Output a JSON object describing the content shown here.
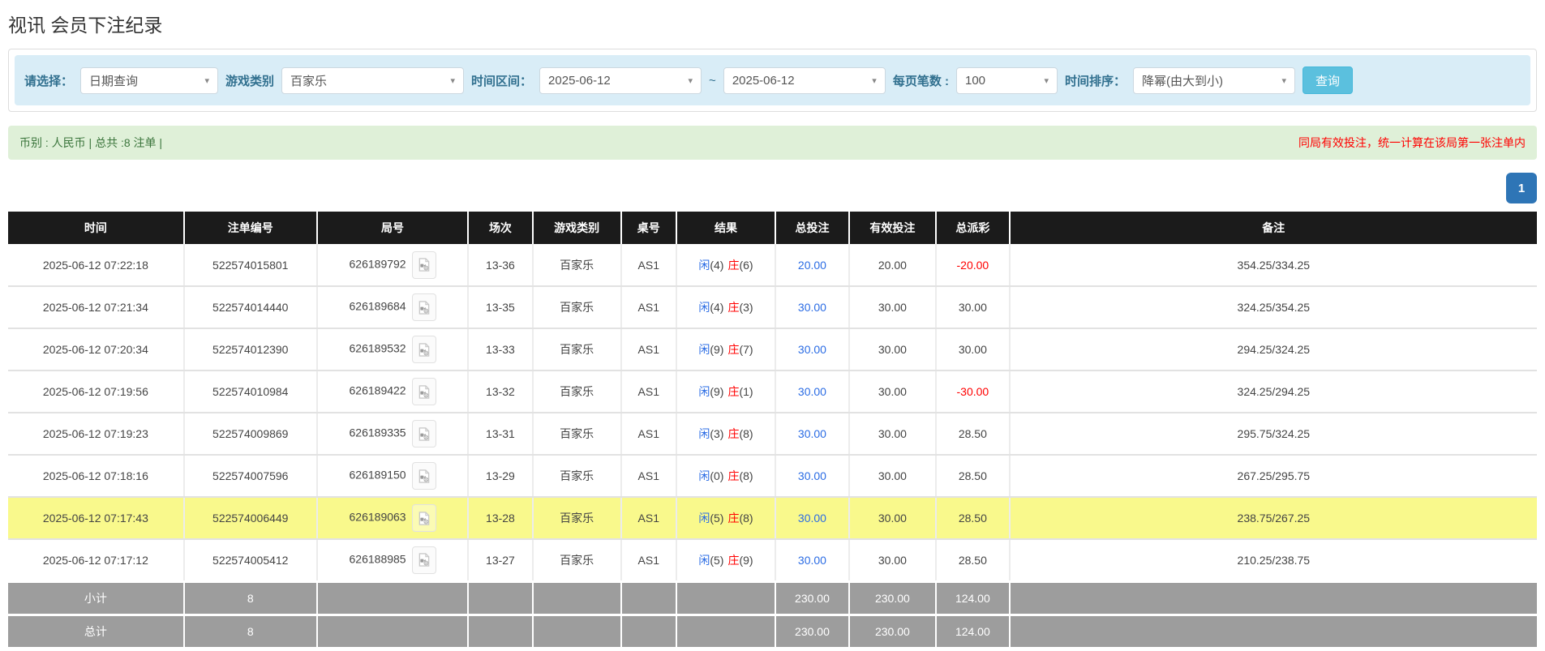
{
  "page": {
    "title": "视讯 会员下注纪录"
  },
  "filters": {
    "select_label": "请选择：",
    "select_value": "日期查询",
    "game_type_label": "游戏类别",
    "game_type_value": "百家乐",
    "date_range_label": "时间区间：",
    "date_from": "2025-06-12",
    "tilde": "~",
    "date_to": "2025-06-12",
    "page_size_label": "每页笔数 :",
    "page_size_value": "100",
    "sort_label": "时间排序：",
    "sort_value": "降幂(由大到小)",
    "search_button": "查询"
  },
  "summary": {
    "left": "币别 : 人民币 | 总共 :8 注单 |",
    "right": "同局有效投注，统一计算在该局第一张注单内"
  },
  "pagination": {
    "page": "1"
  },
  "icons": {
    "dropdown_arrow": "▾",
    "video_icon_name": "video-replay-icon"
  },
  "colors": {
    "filter_bar_bg": "#d9edf7",
    "filter_label": "#31708f",
    "search_button_bg": "#5bc0de",
    "summary_green_bg": "#dff0d8",
    "summary_text_green": "#3c763d",
    "notice_red": "#ff0000",
    "pagination_bg": "#2e75b6",
    "header_bg": "#1b1b1b",
    "highlight_row": "#f9f98c",
    "amount_blue": "#2b6ce4",
    "negative_red": "#ff0000",
    "footer_bg": "#9d9d9d"
  },
  "table": {
    "headers": [
      "时间",
      "注单编号",
      "局号",
      "场次",
      "游戏类别",
      "桌号",
      "结果",
      "总投注",
      "有效投注",
      "总派彩",
      "备注"
    ],
    "rows": [
      {
        "time": "2025-06-12 07:22:18",
        "bet_id": "522574015801",
        "round_id": "626189792",
        "session": "13-36",
        "game": "百家乐",
        "table_no": "AS1",
        "result": {
          "player_label": "闲",
          "player_score": "(4)",
          "banker_label": "庄",
          "banker_score": "(6)"
        },
        "total_bet": "20.00",
        "valid_bet": "20.00",
        "payout": "-20.00",
        "remark": "354.25/334.25",
        "highlight": false
      },
      {
        "time": "2025-06-12 07:21:34",
        "bet_id": "522574014440",
        "round_id": "626189684",
        "session": "13-35",
        "game": "百家乐",
        "table_no": "AS1",
        "result": {
          "player_label": "闲",
          "player_score": "(4)",
          "banker_label": "庄",
          "banker_score": "(3)"
        },
        "total_bet": "30.00",
        "valid_bet": "30.00",
        "payout": "30.00",
        "remark": "324.25/354.25",
        "highlight": false
      },
      {
        "time": "2025-06-12 07:20:34",
        "bet_id": "522574012390",
        "round_id": "626189532",
        "session": "13-33",
        "game": "百家乐",
        "table_no": "AS1",
        "result": {
          "player_label": "闲",
          "player_score": "(9)",
          "banker_label": "庄",
          "banker_score": "(7)"
        },
        "total_bet": "30.00",
        "valid_bet": "30.00",
        "payout": "30.00",
        "remark": "294.25/324.25",
        "highlight": false
      },
      {
        "time": "2025-06-12 07:19:56",
        "bet_id": "522574010984",
        "round_id": "626189422",
        "session": "13-32",
        "game": "百家乐",
        "table_no": "AS1",
        "result": {
          "player_label": "闲",
          "player_score": "(9)",
          "banker_label": "庄",
          "banker_score": "(1)"
        },
        "total_bet": "30.00",
        "valid_bet": "30.00",
        "payout": "-30.00",
        "remark": "324.25/294.25",
        "highlight": false
      },
      {
        "time": "2025-06-12 07:19:23",
        "bet_id": "522574009869",
        "round_id": "626189335",
        "session": "13-31",
        "game": "百家乐",
        "table_no": "AS1",
        "result": {
          "player_label": "闲",
          "player_score": "(3)",
          "banker_label": "庄",
          "banker_score": "(8)"
        },
        "total_bet": "30.00",
        "valid_bet": "30.00",
        "payout": "28.50",
        "remark": "295.75/324.25",
        "highlight": false
      },
      {
        "time": "2025-06-12 07:18:16",
        "bet_id": "522574007596",
        "round_id": "626189150",
        "session": "13-29",
        "game": "百家乐",
        "table_no": "AS1",
        "result": {
          "player_label": "闲",
          "player_score": "(0)",
          "banker_label": "庄",
          "banker_score": "(8)"
        },
        "total_bet": "30.00",
        "valid_bet": "30.00",
        "payout": "28.50",
        "remark": "267.25/295.75",
        "highlight": false
      },
      {
        "time": "2025-06-12 07:17:43",
        "bet_id": "522574006449",
        "round_id": "626189063",
        "session": "13-28",
        "game": "百家乐",
        "table_no": "AS1",
        "result": {
          "player_label": "闲",
          "player_score": "(5)",
          "banker_label": "庄",
          "banker_score": "(8)"
        },
        "total_bet": "30.00",
        "valid_bet": "30.00",
        "payout": "28.50",
        "remark": "238.75/267.25",
        "highlight": true
      },
      {
        "time": "2025-06-12 07:17:12",
        "bet_id": "522574005412",
        "round_id": "626188985",
        "session": "13-27",
        "game": "百家乐",
        "table_no": "AS1",
        "result": {
          "player_label": "闲",
          "player_score": "(5)",
          "banker_label": "庄",
          "banker_score": "(9)"
        },
        "total_bet": "30.00",
        "valid_bet": "30.00",
        "payout": "28.50",
        "remark": "210.25/238.75",
        "highlight": false
      }
    ],
    "footer": [
      {
        "label": "小计",
        "count": "8",
        "total_bet": "230.00",
        "valid_bet": "230.00",
        "payout": "124.00"
      },
      {
        "label": "总计",
        "count": "8",
        "total_bet": "230.00",
        "valid_bet": "230.00",
        "payout": "124.00"
      }
    ]
  }
}
